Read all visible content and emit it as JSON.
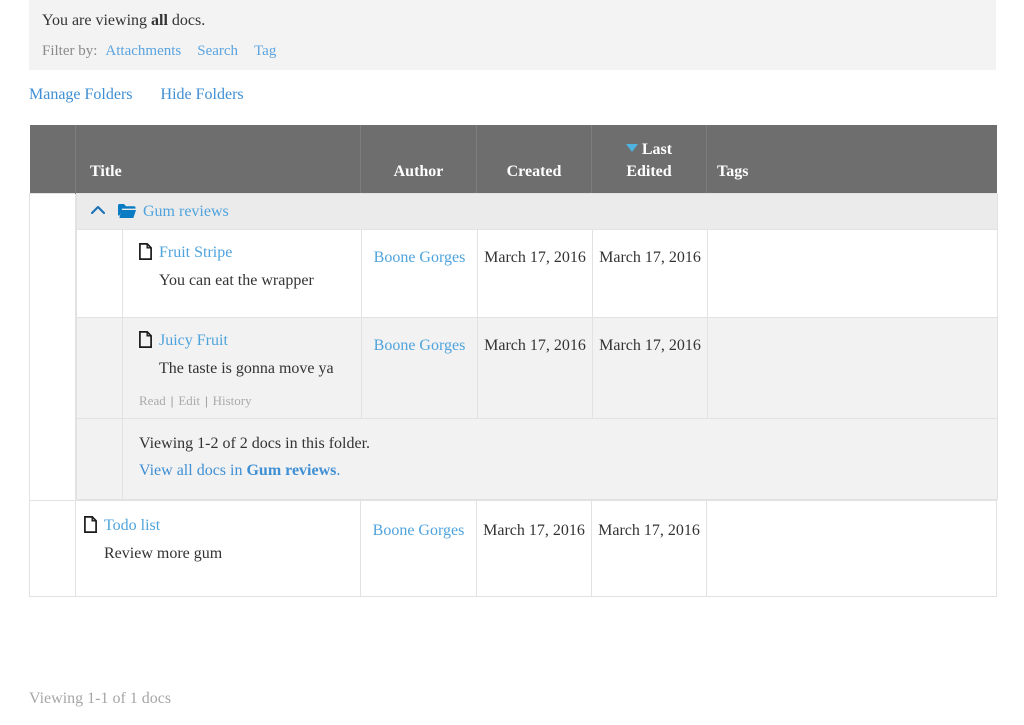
{
  "notice": {
    "prefix": "You are viewing ",
    "scope": "all",
    "suffix": " docs.",
    "filter_label": "Filter by:",
    "filter_links": [
      {
        "label": "Attachments",
        "name": "filter-attachments"
      },
      {
        "label": "Search",
        "name": "filter-search"
      },
      {
        "label": "Tag",
        "name": "filter-tag"
      }
    ]
  },
  "folder_actions": [
    {
      "label": "Manage Folders",
      "name": "manage-folders-link"
    },
    {
      "label": "Hide Folders",
      "name": "hide-folders-link"
    }
  ],
  "table": {
    "columns": {
      "spacer": "",
      "title": "Title",
      "author": "Author",
      "created": "Created",
      "last_edited": "Last Edited",
      "last_edited_line1": "Last",
      "last_edited_line2": "Edited",
      "tags": "Tags"
    },
    "sort": {
      "column": "Last Edited",
      "direction": "desc",
      "caret_color": "#4fb3e0"
    }
  },
  "folder": {
    "icon": "folder-open-icon",
    "toggle_icon": "chevron-up-icon",
    "name": "Gum reviews",
    "expanded": true,
    "docs": [
      {
        "icon": "document-icon",
        "title": "Fruit Stripe",
        "excerpt": "You can eat the wrapper",
        "author": "Boone Gorges",
        "created": "March 17, 2016",
        "last_edited": "March 17, 2016",
        "tags": "",
        "actions": []
      },
      {
        "icon": "document-icon",
        "title": "Juicy Fruit",
        "excerpt": "The taste is gonna move ya",
        "author": "Boone Gorges",
        "created": "March 17, 2016",
        "last_edited": "March 17, 2016",
        "tags": "",
        "actions": [
          "Read",
          "Edit",
          "History"
        ]
      }
    ],
    "footer": {
      "count_text": "Viewing 1-2 of 2 docs in this folder.",
      "view_all_prefix": "View all docs in ",
      "view_all_folder": "Gum reviews",
      "view_all_suffix": "."
    }
  },
  "top_level_docs": [
    {
      "icon": "document-icon",
      "title": "Todo list",
      "excerpt": "Review more gum",
      "author": "Boone Gorges",
      "created": "March 17, 2016",
      "last_edited": "March 17, 2016",
      "tags": ""
    }
  ],
  "bottom_count": "Viewing 1-1 of 1 docs",
  "colors": {
    "header_bg": "#6e6e6e",
    "notice_bg": "#f3f3f3",
    "link_blue": "#4fa3dd",
    "link_blue_dark": "#3f8fd4",
    "folder_icon_blue": "#0a7cc4",
    "row_alt_bg": "#f2f2f2",
    "folder_row_bg": "#ebebeb",
    "border": "#e2e2e2",
    "muted_text": "#a6a6a6"
  }
}
